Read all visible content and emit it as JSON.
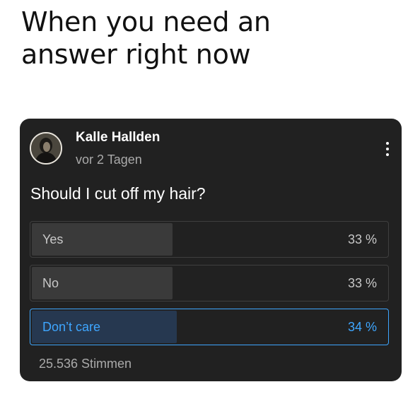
{
  "meme": {
    "caption_line1": "When you need an",
    "caption_line2": "answer right now"
  },
  "post": {
    "author": "Kalle Hallden",
    "time": "vor 2 Tagen",
    "avatar_icon": "profile-photo",
    "more_icon": "vertical-ellipsis-icon",
    "question": "Should I cut off my hair?",
    "options": [
      {
        "label": "Yes",
        "percent_text": "33 %",
        "fill_fraction": 0.33,
        "selected": false
      },
      {
        "label": "No",
        "percent_text": "33 %",
        "fill_fraction": 0.33,
        "selected": false
      },
      {
        "label": "Don’t care",
        "percent_text": "34 %",
        "fill_fraction": 0.34,
        "selected": true
      }
    ],
    "votes": "25.536 Stimmen"
  },
  "colors": {
    "card_background": "#212121",
    "option_fill": "#3a3a3a",
    "selected_accent": "#3ea6ff",
    "selected_fill": "#263850",
    "muted_text": "#aaaaaa"
  }
}
